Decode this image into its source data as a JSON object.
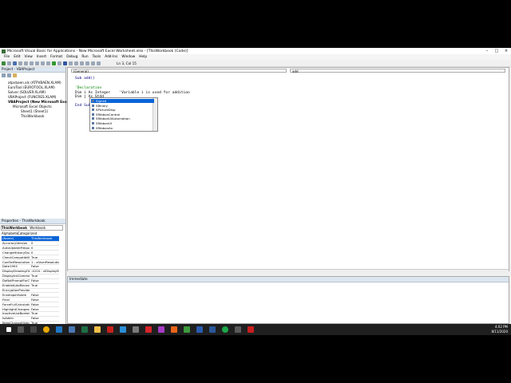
{
  "window": {
    "title": "Microsoft Visual Basic for Applications - New Microsoft Excel Worksheet.xlsx - [ThisWorkbook (Code)]",
    "controls": [
      "–",
      "□",
      "×"
    ]
  },
  "menu": [
    "File",
    "Edit",
    "View",
    "Insert",
    "Format",
    "Debug",
    "Run",
    "Tools",
    "Add-Ins",
    "Window",
    "Help"
  ],
  "toolbar": {
    "status": "Ln 3, Col 15"
  },
  "project_panel": {
    "header": "Project - VBAProject",
    "items": [
      "atpvbaen.xls (ATPVBAEN.XLAM)",
      "EuroTool (EUROTOOL.XLAM)",
      "Solver (SOLVER.XLAM)",
      "VBAProject (FUNCRES.XLAM)",
      "VBAProject (New Microsoft Excel W",
      "Microsoft Excel Objects",
      "Sheet1 (Sheet1)",
      "ThisWorkbook"
    ]
  },
  "properties_panel": {
    "header": "Properties - ThisWorkbook",
    "object": "ThisWorkbook",
    "object_type": "Workbook",
    "tabs": [
      "Alphabetic",
      "Categorized"
    ],
    "rows": [
      [
        "(Name)",
        "ThisWorkbook"
      ],
      [
        "AccuracyVersion",
        "0"
      ],
      [
        "AutoUpdateFrequenc",
        "0"
      ],
      [
        "ChangeHistoryDurati",
        "0"
      ],
      [
        "CheckCompatibility",
        "True"
      ],
      [
        "ConflictResolution",
        "1 - xlUserResolution"
      ],
      [
        "Date1904",
        "False"
      ],
      [
        "DisplayDrawingObject",
        "-4104 - xlDisplayShapes"
      ],
      [
        "DisplayInkComments",
        "True"
      ],
      [
        "DoNotPromptForConv",
        "False"
      ],
      [
        "EnableAutoRecover",
        "True"
      ],
      [
        "EncryptionProvider",
        ""
      ],
      [
        "EnvelopeVisible",
        "False"
      ],
      [
        "Final",
        "False"
      ],
      [
        "ForceFullCalculation",
        "False"
      ],
      [
        "HighlightChangesOnS",
        "False"
      ],
      [
        "InactiveListBorderVis",
        "True"
      ],
      [
        "IsAddin",
        "False"
      ],
      [
        "KeepChangeHistory",
        "True"
      ]
    ]
  },
  "code_window": {
    "object_combo": "(General)",
    "proc_combo": "add",
    "lines": [
      {
        "text": "Sub add()",
        "cls": "kw"
      },
      {
        "text": "",
        "cls": ""
      },
      {
        "text": "'Declaration",
        "cls": "cm"
      },
      {
        "text": "Dim i As Integer    'Variable i is used for addition",
        "cls": ""
      },
      {
        "text": "Dim j As Stdd",
        "cls": ""
      },
      {
        "text": "",
        "cls": ""
      },
      {
        "text": "End Sub",
        "cls": "kw"
      }
    ],
    "autocomplete": [
      "Signed",
      "SBinary",
      "SPictureDisp",
      "SRibbonControl",
      "SRibbonUIAutomation",
      "SRibbonUI",
      "SRibbonAx"
    ]
  },
  "immediate": {
    "header": "Immediate"
  },
  "clock": {
    "time": "4:02 PM",
    "date": "8/11/2020"
  }
}
